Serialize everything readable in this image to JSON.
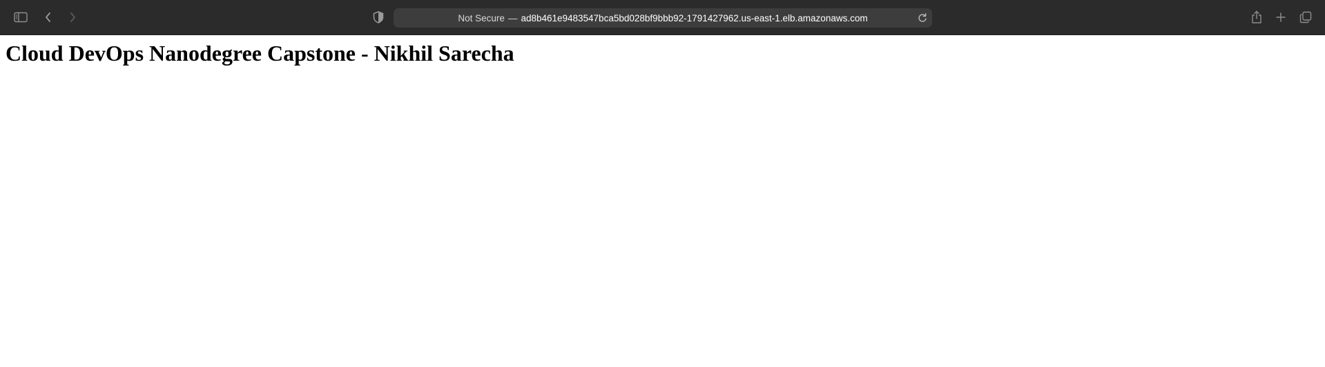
{
  "browser": {
    "toolbar": {
      "sidebar_icon": "sidebar-icon",
      "back_icon": "chevron-left-icon",
      "forward_icon": "chevron-right-icon",
      "privacy_icon": "shield-icon",
      "share_icon": "share-icon",
      "new_tab_icon": "plus-icon",
      "tabs_overview_icon": "tabs-icon"
    },
    "address": {
      "security_label": "Not Secure",
      "separator": "—",
      "host": "ad8b461e9483547bca5bd028bf9bbb92-1791427962.us-east-1.elb.amazonaws.com",
      "reload_icon": "reload-icon"
    },
    "colors": {
      "toolbar_bg": "#2b2b2b",
      "address_bg": "#3d3d3d",
      "page_bg": "#ffffff"
    }
  },
  "page": {
    "heading": "Cloud DevOps Nanodegree Capstone - Nikhil Sarecha"
  }
}
